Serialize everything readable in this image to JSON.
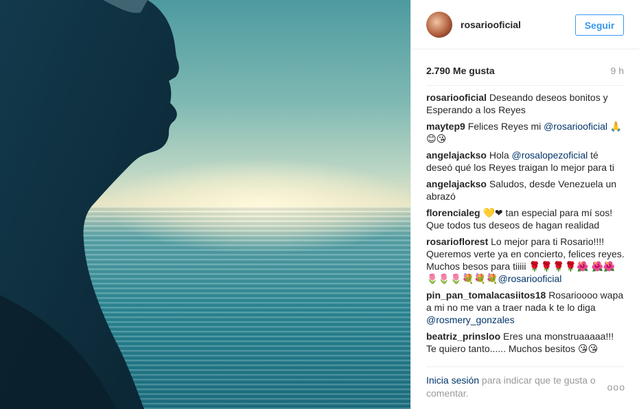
{
  "post": {
    "username": "rosariooficial",
    "follow_label": "Seguir",
    "likes": "2.790 Me gusta",
    "time": "9 h"
  },
  "comments": [
    {
      "author": "rosariooficial",
      "parts": [
        {
          "t": "Deseando deseos bonitos y Esperando a los Reyes"
        }
      ]
    },
    {
      "author": "maytep9",
      "parts": [
        {
          "t": "Felices Reyes mi "
        },
        {
          "m": "@rosariooficial"
        },
        {
          "t": " 🙏 😊😘"
        }
      ]
    },
    {
      "author": "angelajackso",
      "parts": [
        {
          "t": "Hola "
        },
        {
          "m": "@rosalopezoficial"
        },
        {
          "t": " té deseó qué los Reyes traigan lo mejor para ti"
        }
      ]
    },
    {
      "author": "angelajackso",
      "parts": [
        {
          "t": "Saludos, desde Venezuela un abrazó"
        }
      ]
    },
    {
      "author": "florencialeg",
      "parts": [
        {
          "t": "💛❤ tan especial para mí sos! Que todos tus deseos de hagan realidad"
        }
      ]
    },
    {
      "author": "rosarioflorest",
      "parts": [
        {
          "t": "Lo mejor para ti Rosario!!!! Queremos verte ya en concierto, felices reyes. Muchos besos para tiiiii 🌹🌹🌹🌹🌺 🌺🌺🌷🌷🌷💐💐💐"
        },
        {
          "m": "@rosariooficial"
        }
      ]
    },
    {
      "author": "pin_pan_tomalacasiitos18",
      "parts": [
        {
          "t": "Rosarioooo wapa a mi no me van a traer nada k te lo diga "
        },
        {
          "m": "@rosmery_gonzales"
        }
      ]
    },
    {
      "author": "beatriz_prinsloo",
      "parts": [
        {
          "t": "Eres una monstruaaaaa!!! Te quiero tanto...... Muchos besitos 😘😘"
        }
      ]
    }
  ],
  "footer": {
    "login_link": "Inicia sesión",
    "text": " para indicar que te gusta o comentar.",
    "more": "ooo"
  }
}
